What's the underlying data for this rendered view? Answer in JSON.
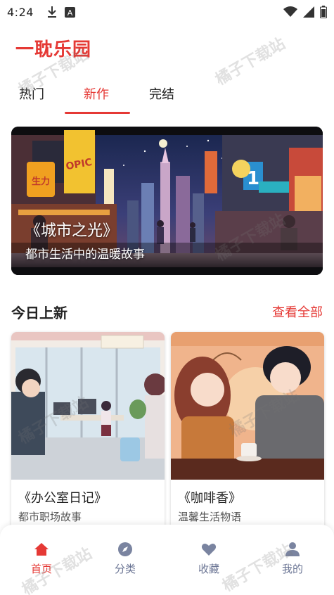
{
  "status_bar": {
    "time": "4:24",
    "icons": [
      "download-icon",
      "notification-a-icon",
      "wifi-icon",
      "signal-icon",
      "battery-icon"
    ]
  },
  "app": {
    "title": "一耽乐园",
    "accent_color": "#e53935"
  },
  "tabs": [
    {
      "label": "热门",
      "active": false
    },
    {
      "label": "新作",
      "active": true
    },
    {
      "label": "完结",
      "active": false
    }
  ],
  "banner": {
    "title": "《城市之光》",
    "subtitle": "都市生活中的温暖故事",
    "signs": [
      "OPIC",
      "生力"
    ]
  },
  "section": {
    "title": "今日上新",
    "view_all": "查看全部"
  },
  "cards": [
    {
      "title": "《办公室日记》",
      "subtitle": "都市职场故事"
    },
    {
      "title": "《咖啡香》",
      "subtitle": "温馨生活物语"
    }
  ],
  "bottom_nav": [
    {
      "label": "首页",
      "icon": "home-icon",
      "active": true
    },
    {
      "label": "分类",
      "icon": "compass-icon",
      "active": false
    },
    {
      "label": "收藏",
      "icon": "heart-icon",
      "active": false
    },
    {
      "label": "我的",
      "icon": "user-icon",
      "active": false
    }
  ],
  "watermark": "橘子下载站"
}
